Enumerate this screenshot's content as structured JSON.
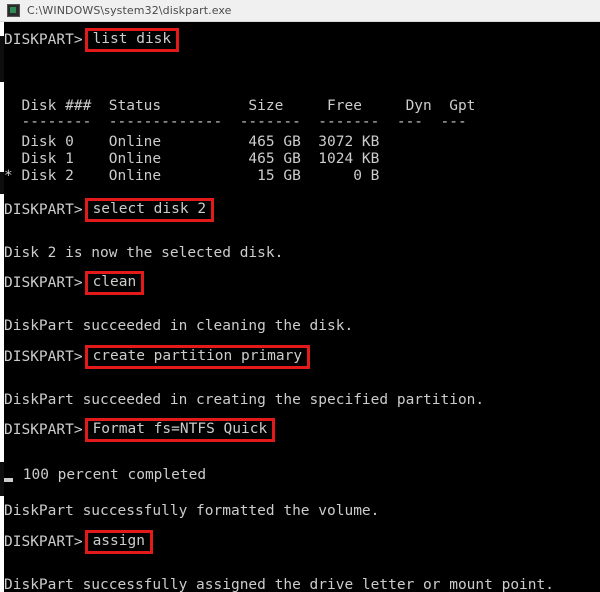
{
  "window": {
    "title": "C:\\WINDOWS\\system32\\diskpart.exe",
    "icon": "console-icon",
    "background_color": "#000000",
    "text_color": "#cccccc",
    "highlight_color": "#e31a1a",
    "titlebar_color": "#f0f0f0"
  },
  "console": {
    "prompt": "DISKPART>",
    "cursor": "_",
    "commands": {
      "list_disk": "list disk",
      "select_disk": "select disk 2",
      "clean": "clean",
      "create_partition": "create partition primary",
      "format": "Format fs=NTFS Quick",
      "assign": "assign"
    },
    "disk_table": {
      "headers": "  Disk ###  Status          Size     Free     Dyn  Gpt",
      "separator": "  --------  -------------  -------  -------  ---  ---",
      "rows": [
        "  Disk 0    Online          465 GB  3072 KB",
        "  Disk 1    Online          465 GB  1024 KB",
        "* Disk 2    Online           15 GB      0 B"
      ]
    },
    "outputs": {
      "selected": "Disk 2 is now the selected disk.",
      "cleaned": "DiskPart succeeded in cleaning the disk.",
      "created": "DiskPart succeeded in creating the specified partition.",
      "percent": " 100 percent completed",
      "formatted": "DiskPart successfully formatted the volume.",
      "assigned": "DiskPart successfully assigned the drive letter or mount point."
    }
  },
  "table_data": {
    "type": "table",
    "title": "list disk output",
    "columns": [
      "",
      "Disk ###",
      "Status",
      "Size",
      "Free",
      "Dyn",
      "Gpt"
    ],
    "rows": [
      [
        "",
        "Disk 0",
        "Online",
        "465 GB",
        "3072 KB",
        "",
        ""
      ],
      [
        "",
        "Disk 1",
        "Online",
        "465 GB",
        "1024 KB",
        "",
        ""
      ],
      [
        "*",
        "Disk 2",
        "Online",
        "15 GB",
        "0 B",
        "",
        ""
      ]
    ]
  }
}
